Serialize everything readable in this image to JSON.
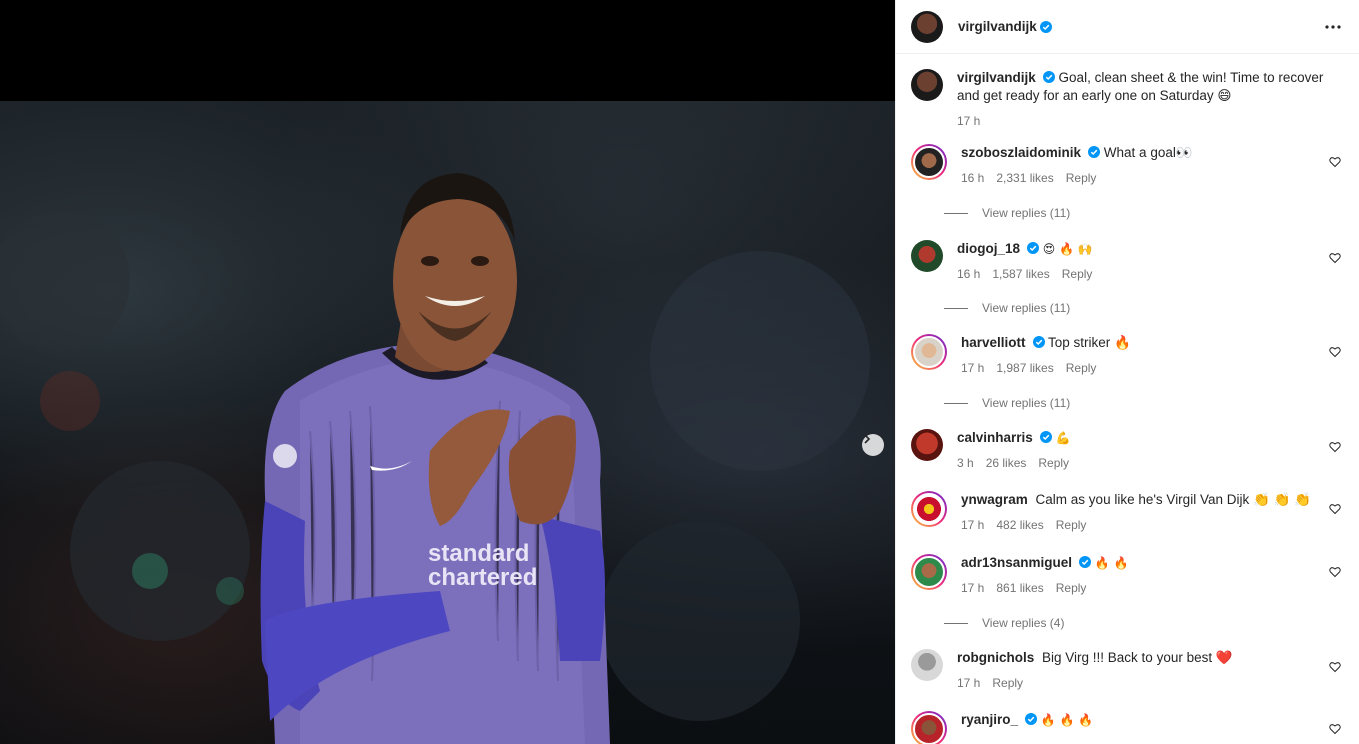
{
  "post": {
    "author": "virgilvandijk",
    "caption": "Goal, clean sheet & the win! Time to recover and get ready for an early one on Saturday 😄",
    "time": "17 h"
  },
  "media": {
    "jersey_sponsor_line1": "standard",
    "jersey_sponsor_line2": "chartered"
  },
  "comments": [
    {
      "user": "szoboszlaidominik",
      "verified": true,
      "text": "What a goal👀",
      "time": "16 h",
      "likes": "2,331 likes",
      "reply": "Reply",
      "view_replies": "View replies (11)"
    },
    {
      "user": "diogoj_18",
      "verified": true,
      "text": "😍 🔥 🙌",
      "time": "16 h",
      "likes": "1,587 likes",
      "reply": "Reply",
      "view_replies": "View replies (11)"
    },
    {
      "user": "harvelliott",
      "verified": true,
      "text": "Top striker 🔥",
      "time": "17 h",
      "likes": "1,987 likes",
      "reply": "Reply",
      "view_replies": "View replies (11)"
    },
    {
      "user": "calvinharris",
      "verified": true,
      "text": "💪",
      "time": "3 h",
      "likes": "26 likes",
      "reply": "Reply"
    },
    {
      "user": "ynwagram",
      "verified": false,
      "text": "Calm as you like he's Virgil Van Dijk 👏 👏 👏",
      "time": "17 h",
      "likes": "482 likes",
      "reply": "Reply"
    },
    {
      "user": "adr13nsanmiguel",
      "verified": true,
      "text": "🔥 🔥",
      "time": "17 h",
      "likes": "861 likes",
      "reply": "Reply",
      "view_replies": "View replies (4)"
    },
    {
      "user": "robgnichols",
      "verified": false,
      "text": "Big Virg !!! Back to your best ❤️",
      "time": "17 h",
      "reply": "Reply"
    },
    {
      "user": "ryanjiro_",
      "verified": true,
      "text": "🔥 🔥 🔥"
    }
  ],
  "colors": {
    "verified": "#0095f6",
    "muted": "#737373",
    "text": "#262626",
    "jersey": "#7a6fb8"
  }
}
